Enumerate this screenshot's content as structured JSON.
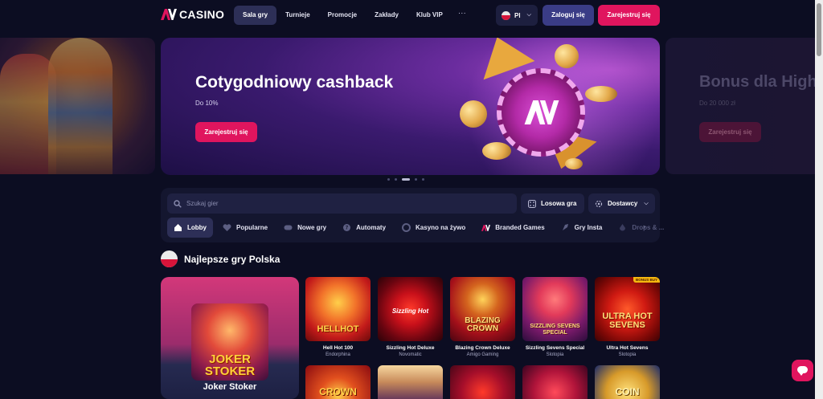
{
  "header": {
    "logo_text": "CASINO",
    "nav": [
      "Sala gry",
      "Turnieje",
      "Promocje",
      "Zakłady",
      "Klub VIP"
    ],
    "more": "···",
    "lang": "Pl",
    "login": "Zaloguj się",
    "register": "Zarejestruj się"
  },
  "hero": {
    "title": "Cotygodniowy cashback",
    "subtitle": "Do 10%",
    "button": "Zarejestruj się"
  },
  "next_banner": {
    "title": "Bonus dla High",
    "subtitle": "Do 20 000 zł",
    "button": "Zarejestruj się"
  },
  "search": {
    "placeholder": "Szukaj gier",
    "random": "Losowa gra",
    "providers": "Dostawcy"
  },
  "categories": [
    "Lobby",
    "Popularne",
    "Nowe gry",
    "Automaty",
    "Kasyno na żywo",
    "Branded Games",
    "Gry Insta",
    "Drops & ..."
  ],
  "section": {
    "title": "Najlepsze gry Polska"
  },
  "featured": {
    "art_label": "JOKER STOKER",
    "name": "Joker Stoker"
  },
  "games": [
    {
      "name": "Hell Hot 100",
      "provider": "Endorphina",
      "art": "HELLHOT"
    },
    {
      "name": "Sizzling Hot Deluxe",
      "provider": "Novomatic",
      "art": "Sizzling Hot"
    },
    {
      "name": "Blazing Crown Deluxe",
      "provider": "Amigo Gaming",
      "art": "BLAZING CROWN"
    },
    {
      "name": "Sizzling Sevens Special",
      "provider": "Slotopia",
      "art": "SIZZLING SEVENS SPECIAL"
    },
    {
      "name": "Ultra Hot Sevens",
      "provider": "Slotopia",
      "art": "ULTRA HOT SEVENS",
      "badge": "BONUS BUY"
    }
  ],
  "row2": [
    "CROWN",
    "",
    "",
    "",
    "COIN"
  ]
}
